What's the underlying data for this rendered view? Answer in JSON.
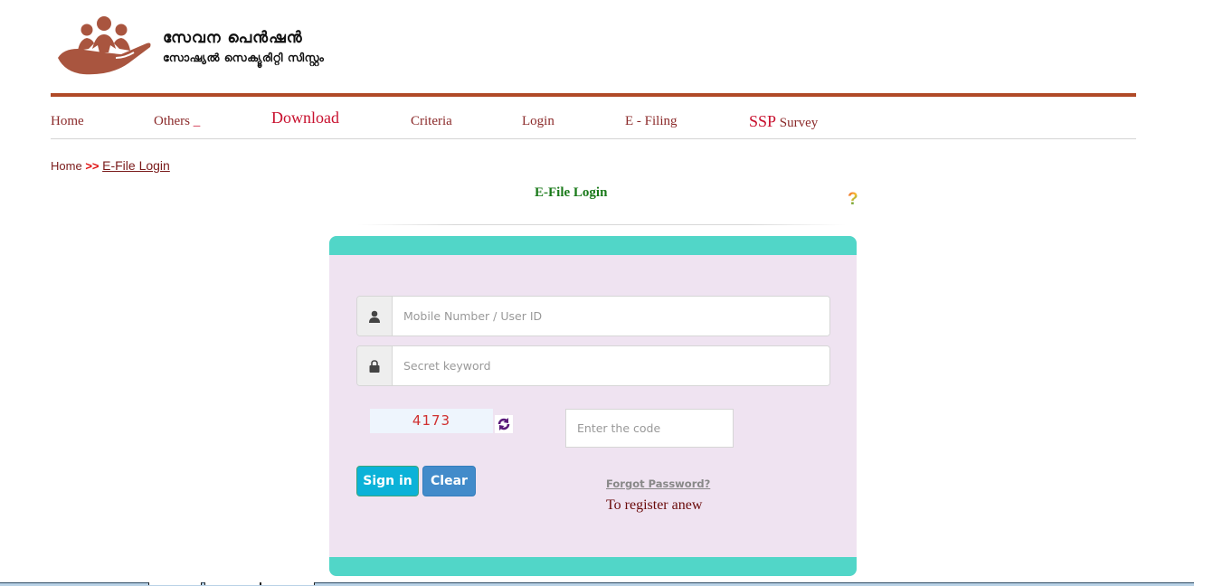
{
  "brand": {
    "title": "സേവന പെൻഷൻ",
    "subtitle": "സോഷ്യൽ സെക്യൂരിറ്റി സിസ്റ്റം",
    "logo_icon": "hand-holding-people-icon",
    "color": "#a9553f"
  },
  "nav": {
    "items": [
      {
        "label": "Home"
      },
      {
        "label": "Others",
        "suffix": "_"
      },
      {
        "label": "Download"
      },
      {
        "label": "Criteria"
      },
      {
        "label": "Login"
      },
      {
        "label": "E - Filing"
      },
      {
        "label_highlight": "SSP",
        "label": "Survey"
      }
    ],
    "rule_color": "#b04a27"
  },
  "breadcrumb": {
    "home": "Home",
    "separator": ">>",
    "current": "E-File Login"
  },
  "page": {
    "heading": "E-File Login",
    "help_icon": "?"
  },
  "form": {
    "user_field": {
      "placeholder": "Mobile Number / User ID",
      "value": "",
      "icon": "user-icon"
    },
    "password_field": {
      "placeholder": "Secret keyword",
      "value": "",
      "icon": "lock-icon"
    },
    "captcha": {
      "code": "4173",
      "refresh_icon": "refresh-icon"
    },
    "code_field": {
      "placeholder": "Enter the code",
      "value": ""
    },
    "signin_label": "Sign in",
    "clear_label": "Clear",
    "forgot_label": "Forgot Password?",
    "register_label": "To register anew",
    "accent_color": "#51d6c8",
    "panel_color": "#efe3f1"
  }
}
